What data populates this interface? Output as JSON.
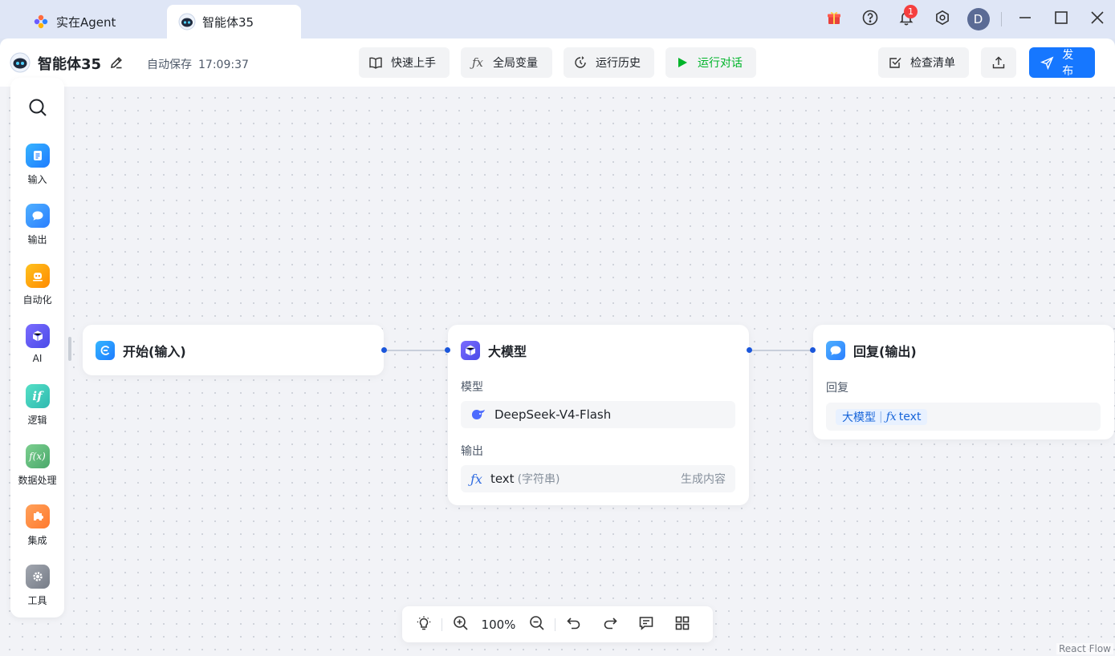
{
  "window": {
    "tabs": [
      {
        "label": "实在Agent",
        "active": false
      },
      {
        "label": "智能体35",
        "active": true
      }
    ],
    "notification_count": "1",
    "user_initial": "D"
  },
  "toolbar": {
    "agent_name": "智能体35",
    "autosave_label": "自动保存",
    "autosave_time": "17:09:37",
    "quick_start": "快速上手",
    "global_vars": "全局变量",
    "run_history": "运行历史",
    "run_chat": "运行对话",
    "checklist": "检查清单",
    "publish": "发布"
  },
  "sidebar": {
    "items": [
      {
        "label": "输入",
        "icon": "input-icon",
        "color": "#1e90ff"
      },
      {
        "label": "输出",
        "icon": "chat-bubble-icon",
        "color": "#2b8cff"
      },
      {
        "label": "自动化",
        "icon": "robot-icon",
        "color": "#ff9a00"
      },
      {
        "label": "AI",
        "icon": "cube-icon",
        "color": "#5b5bf0"
      },
      {
        "label": "逻辑",
        "icon": "if-icon",
        "color": "#3cc9b5"
      },
      {
        "label": "数据处理",
        "icon": "function-icon",
        "color": "#58b87a"
      },
      {
        "label": "集成",
        "icon": "puzzle-icon",
        "color": "#ff8a3d"
      },
      {
        "label": "工具",
        "icon": "gear-icon",
        "color": "#8a8f99"
      }
    ]
  },
  "nodes": {
    "start": {
      "title": "开始(输入)"
    },
    "llm": {
      "title": "大模型",
      "model_label": "模型",
      "model_value": "DeepSeek-V4-Flash",
      "output_label": "输出",
      "output_name": "text",
      "output_type": "(字符串)",
      "output_desc": "生成内容"
    },
    "reply": {
      "title": "回复(输出)",
      "reply_label": "回复",
      "tag_source": "大模型",
      "tag_var": "text"
    }
  },
  "bottom_bar": {
    "zoom": "100%"
  },
  "footer": {
    "attribution": "React Flow"
  }
}
